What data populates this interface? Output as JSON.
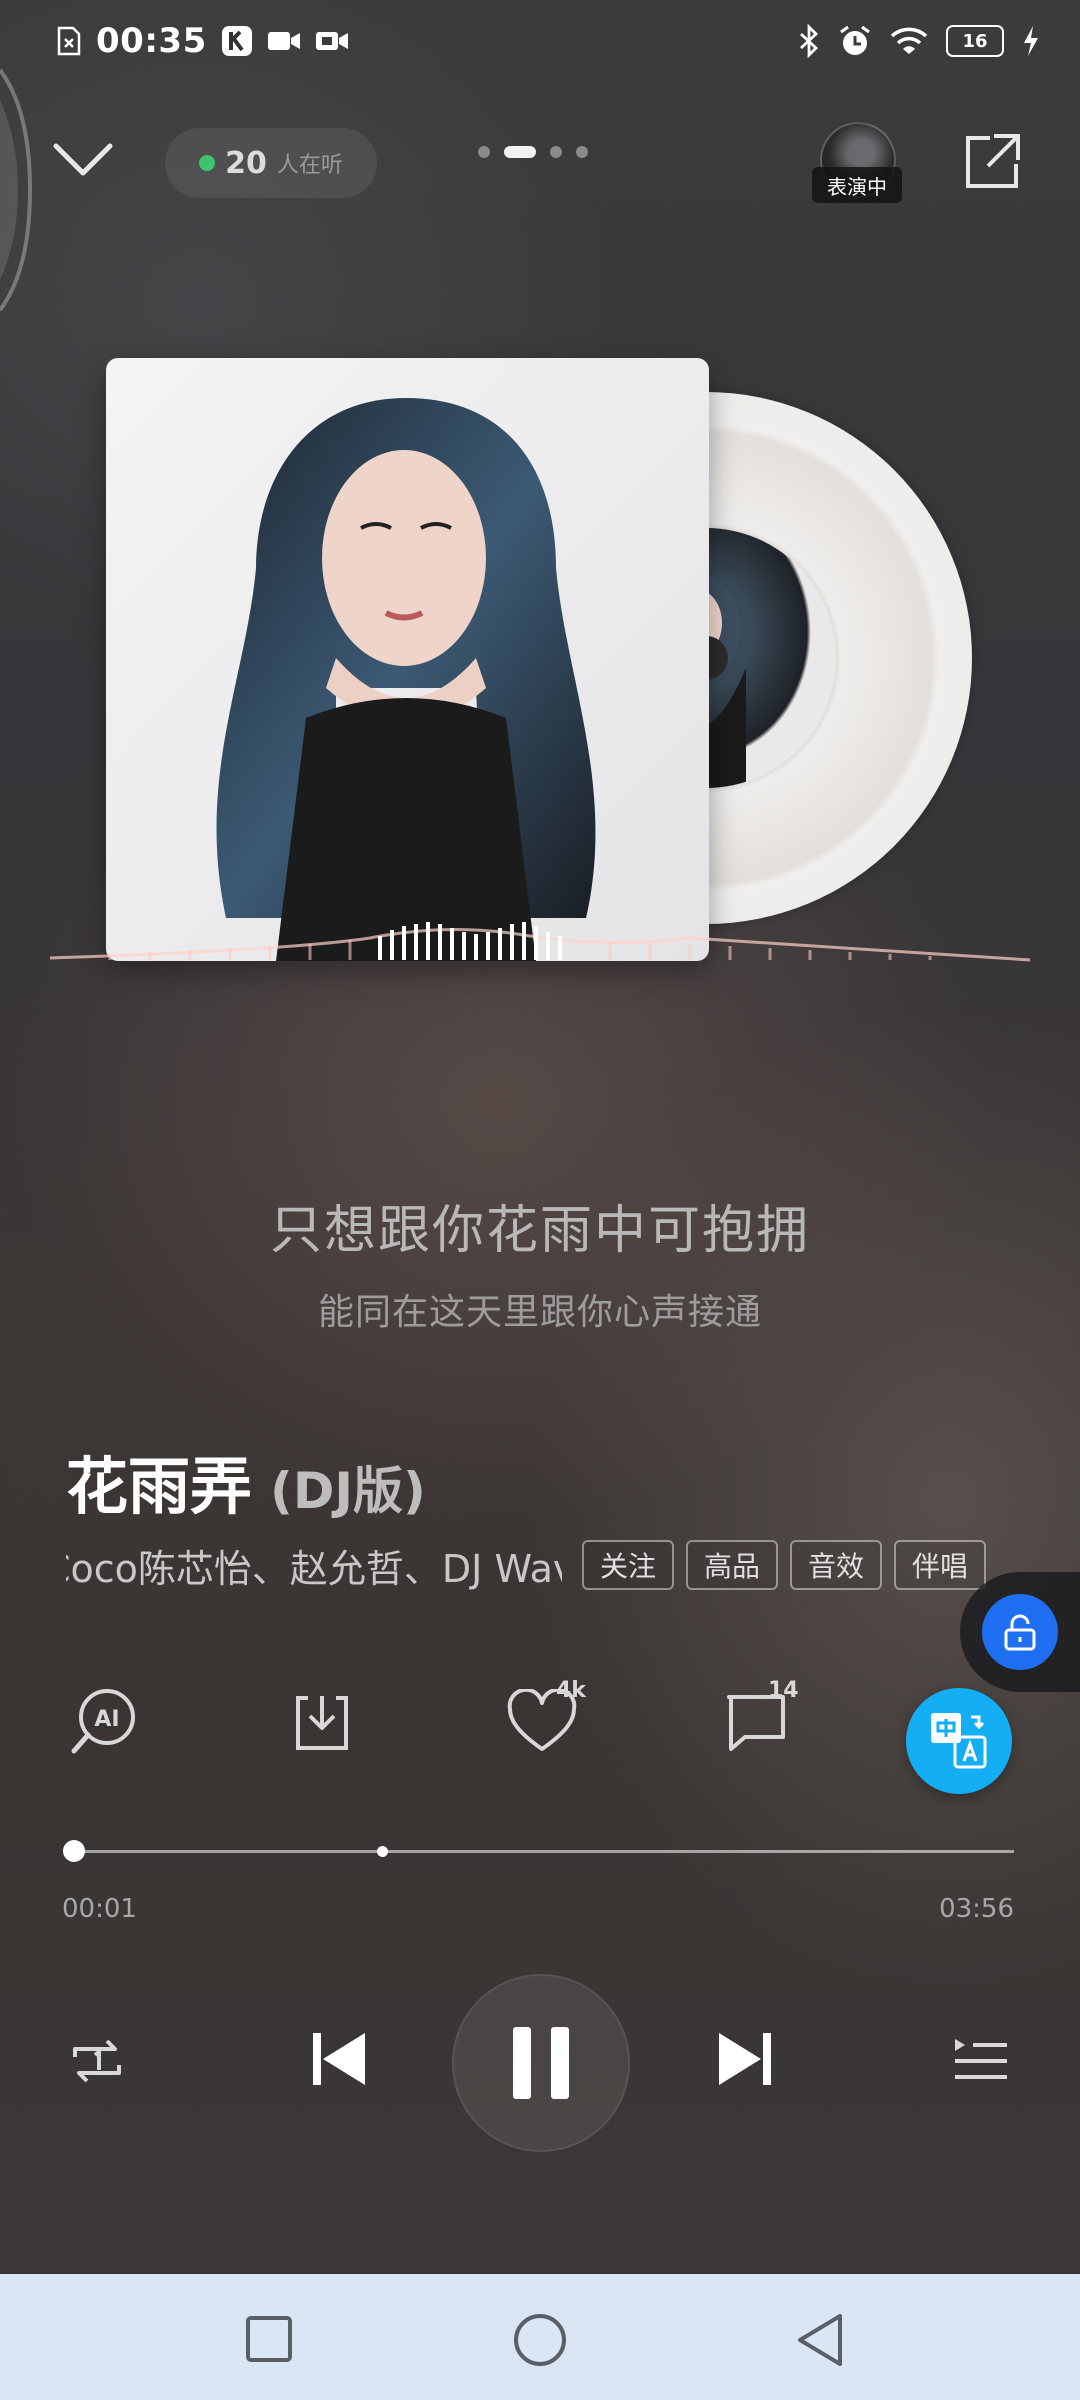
{
  "status_bar": {
    "time": "00:35",
    "battery": "16",
    "icons": [
      "sim-missing-icon",
      "k-app-icon",
      "video-icon",
      "video-call-icon",
      "bluetooth-icon",
      "alarm-icon",
      "wifi-icon",
      "battery-icon",
      "charging-icon"
    ]
  },
  "top_bar": {
    "listeners_count": "20",
    "listeners_label": "人在听",
    "pages": 4,
    "active_page": 1,
    "performer_tag": "表演中",
    "icons": [
      "collapse-chevron-icon",
      "share-icon"
    ]
  },
  "lyrics": {
    "current": "只想跟你花雨中可抱拥",
    "next": "能同在这天里跟你心声接通"
  },
  "song": {
    "title": "花雨弄",
    "version": "(DJ版)",
    "artists": "Coco陈芯怡、赵允哲、DJ Wave"
  },
  "tags": {
    "follow": "关注",
    "quality": "高品",
    "effect": "音效",
    "karaoke": "伴唱"
  },
  "actions": {
    "like_count": "4k",
    "comment_count": "14",
    "ai_label": "AI",
    "icons": [
      "ai-search-icon",
      "download-icon",
      "heart-icon",
      "comment-icon",
      "translate-icon",
      "unlock-icon"
    ]
  },
  "progress": {
    "current": "00:01",
    "total": "03:56",
    "played_fraction": 0.004,
    "buffered_fraction": 0.33
  },
  "controls": {
    "icons": [
      "repeat-one-icon",
      "previous-icon",
      "pause-icon",
      "next-icon",
      "playlist-icon"
    ]
  },
  "nav_bar": {
    "icons": [
      "recents-square-icon",
      "home-circle-icon",
      "back-triangle-icon"
    ]
  },
  "colors": {
    "accent_blue": "#14aef4",
    "lock_blue": "#1f6ff2",
    "live_green": "#3ec46d",
    "nav_bg": "#dbe6f4"
  }
}
